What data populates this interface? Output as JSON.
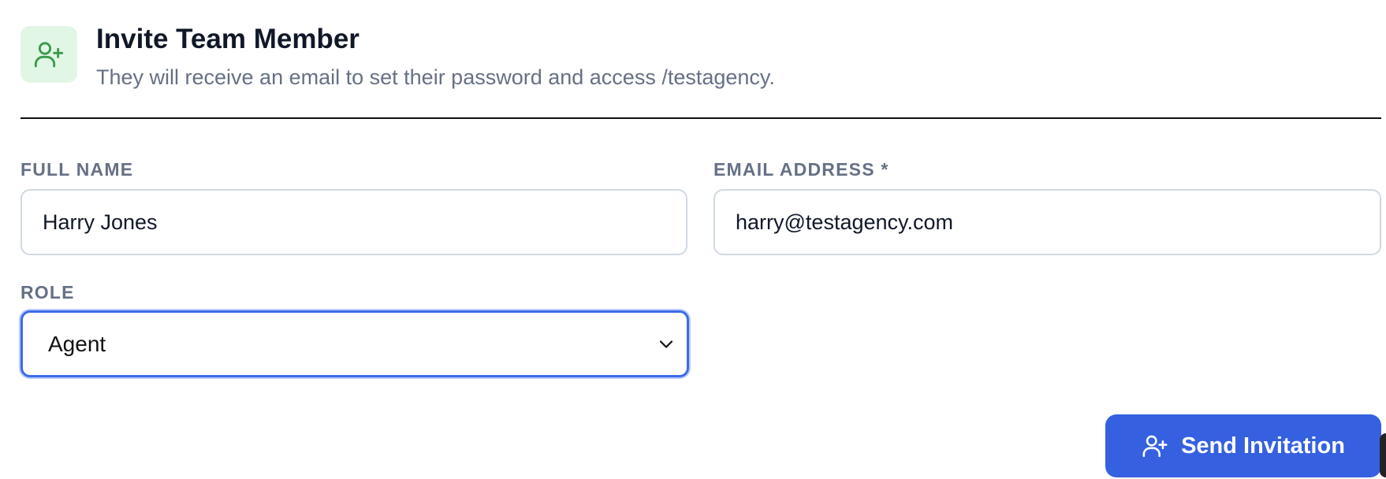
{
  "header": {
    "icon": "user-plus-icon",
    "title": "Invite Team Member",
    "subtitle": "They will receive an email to set their password and access /testagency."
  },
  "form": {
    "full_name": {
      "label": "FULL NAME",
      "value": "Harry Jones"
    },
    "email": {
      "label": "EMAIL ADDRESS *",
      "value": "harry@testagency.com"
    },
    "role": {
      "label": "ROLE",
      "selected": "Agent",
      "icon": "chevron-down-icon"
    }
  },
  "actions": {
    "send_label": "Send Invitation",
    "send_icon": "user-plus-icon"
  },
  "colors": {
    "accent": "#3561e0",
    "icon_bg": "#e2f6e6",
    "icon_stroke": "#3a9a4b",
    "label": "#667085",
    "title": "#101828"
  }
}
